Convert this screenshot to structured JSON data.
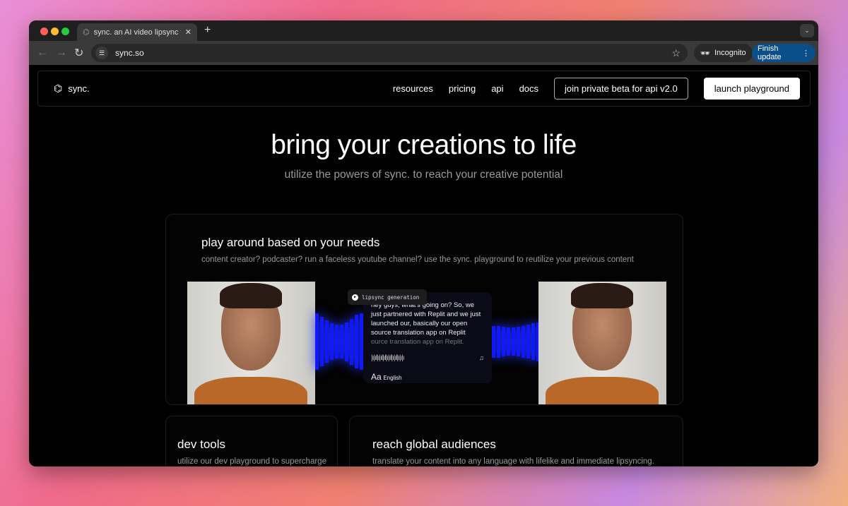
{
  "browser": {
    "tab_title": "sync. an AI video lipsync tool",
    "url": "sync.so",
    "incognito_label": "Incognito",
    "update_label": "Finish update"
  },
  "nav": {
    "logo": "sync.",
    "links": [
      "resources",
      "pricing",
      "api",
      "docs"
    ],
    "beta_button": "join private beta for api v2.0",
    "launch_button": "launch playground"
  },
  "hero": {
    "title": "bring your creations to life",
    "subtitle": "utilize the powers of sync. to reach your creative potential"
  },
  "playground_card": {
    "title": "play around based on your needs",
    "subtitle": "content creator? podcaster? run a faceless youtube channel? use the sync. playground to reutilize your previous content",
    "pill": "lipsync generation",
    "transcript": "hey guys, what's going on? So, we just partnered with Replit and we just launched our, basically our open source translation app  on Replit",
    "transcript_faded": "ource translation app  on Replit.",
    "font_icon": "Aa",
    "language": "English"
  },
  "dev_card": {
    "title": "dev tools",
    "subtitle": "utilize our dev playground to supercharge"
  },
  "global_card": {
    "title": "reach global audiences",
    "subtitle": "translate your content into any language with lifelike and immediate lipsyncing."
  },
  "colors": {
    "accent_blue": "#1018ff",
    "update_button": "#0b4f8a"
  }
}
